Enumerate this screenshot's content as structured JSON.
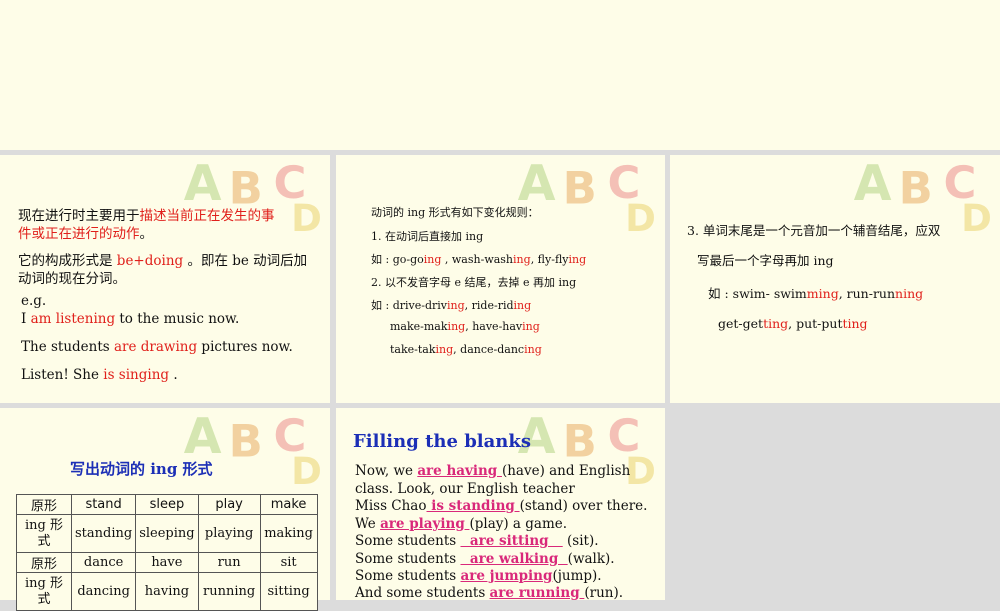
{
  "slide2": {
    "line1a": "现在进行时主要用于",
    "line1b": "描述当前正在发生的事",
    "line2": "件或正在进行的动作",
    "line2end": "。",
    "line3a": "它的构成形式是 ",
    "line3b": "be+doing",
    "line3c": " 。即在 be 动词后加",
    "line4": "动词的现在分词。",
    "eg": "e.g.",
    "ex1a": "I ",
    "ex1b": "am listening",
    "ex1c": " to the music now.",
    "ex2a": "The students ",
    "ex2b": "are drawing",
    "ex2c": " pictures now.",
    "ex3a": "Listen! She ",
    "ex3b": "is singing",
    "ex3c": " ."
  },
  "slide3": {
    "title": "动词的 ing 形式有如下变化规则：",
    "rule1": "1.  在动词后直接加 ing",
    "ex1a": "如 : go-go",
    "ex1b": "ing",
    "ex1c": " , wash-wash",
    "ex1d": "ing",
    "ex1e": ", fly-fly",
    "ex1f": "ing",
    "rule2": "2.  以不发音字母 e 结尾，去掉 e 再加 ing",
    "ex2a": "如 : drive-driv",
    "ex2b": "ing",
    "ex2c": ", ride-rid",
    "ex2d": "ing",
    "ex3a": "make-mak",
    "ex3b": "ing",
    "ex3c": ", have-hav",
    "ex3d": "ing",
    "ex4a": "take-tak",
    "ex4b": "ing",
    "ex4c": ", dance-danc",
    "ex4d": "ing"
  },
  "slide4": {
    "rule3a": "3.  单词末尾是一个元音加一个辅音结尾，应双",
    "rule3b": "写最后一个字母再加 ing",
    "ex1a": "如 : swim- swim",
    "ex1b": "ming",
    "ex1c": ", run-run",
    "ex1d": "ning",
    "ex2a": "get-get",
    "ex2b": "ting",
    "ex2c": ", put-put",
    "ex2d": "ting"
  },
  "slide5": {
    "title": "写出动词的 ing 形式",
    "table": [
      [
        "原形",
        "stand",
        "sleep",
        "play",
        "make"
      ],
      [
        "ing 形式",
        "standing",
        "sleeping",
        "playing",
        "making"
      ],
      [
        "原形",
        "dance",
        "have",
        "run",
        "sit"
      ],
      [
        "ing 形式",
        "dancing",
        "having",
        "running",
        "sitting"
      ]
    ]
  },
  "slide6": {
    "title": "Filling the blanks",
    "l1a": "Now, we ",
    "l1b": " are having ",
    "l1c": " (have) and English",
    "l2": "class. Look, our English teacher",
    "l3a": "Miss Chao",
    "l3b": " is standing ",
    "l3c": " (stand) over there.",
    "l4a": "We ",
    "l4b": " are playing ",
    "l4c": " (play) a game.",
    "l5a": "Some students ",
    "l5b": "  are sitting   ",
    "l5c": " (sit).",
    "l6a": "Some students ",
    "l6b": "  are walking  ",
    "l6c": "(walk).",
    "l7a": "Some students ",
    "l7b": "are jumping",
    "l7c": "(jump).",
    "l8a": "And some students ",
    "l8b": " are running ",
    "l8c": " (run)."
  }
}
